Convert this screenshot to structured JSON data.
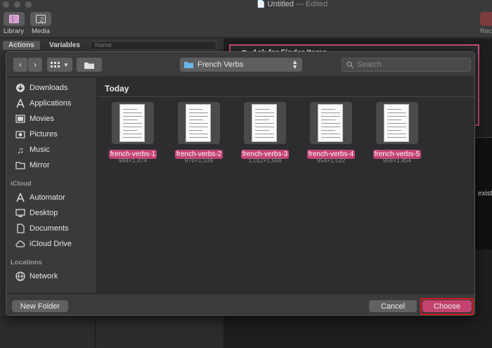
{
  "window": {
    "title": "Untitled",
    "status": " — Edited"
  },
  "toolbar": {
    "library_label": "Library",
    "media_label": "Media",
    "record_label": "Rec"
  },
  "library": {
    "tabs": [
      "Actions",
      "Variables"
    ],
    "search_placeholder": "Name"
  },
  "workflow": {
    "action_title": "Ask for Finder Items",
    "truncated_text": "existin"
  },
  "panel": {
    "location": "French Verbs",
    "search_placeholder": "Search",
    "section_today": "Today",
    "sidebar": {
      "favorites": [
        {
          "label": "Downloads",
          "icon": "downloads-icon"
        },
        {
          "label": "Applications",
          "icon": "applications-icon"
        },
        {
          "label": "Movies",
          "icon": "movies-icon"
        },
        {
          "label": "Pictures",
          "icon": "pictures-icon"
        },
        {
          "label": "Music",
          "icon": "music-icon"
        },
        {
          "label": "Mirror",
          "icon": "folder-icon"
        }
      ],
      "icloud_header": "iCloud",
      "icloud": [
        {
          "label": "Automator",
          "icon": "automator-icon"
        },
        {
          "label": "Desktop",
          "icon": "desktop-icon"
        },
        {
          "label": "Documents",
          "icon": "documents-icon"
        },
        {
          "label": "iCloud Drive",
          "icon": "cloud-icon"
        }
      ],
      "locations_header": "Locations",
      "locations": [
        {
          "label": "Network",
          "icon": "network-icon"
        }
      ]
    },
    "files": [
      {
        "name": "french-verbs-1",
        "dims": "984×1,474"
      },
      {
        "name": "french-verbs-2",
        "dims": "976×1,538"
      },
      {
        "name": "french-verbs-3",
        "dims": "1,012×1,556"
      },
      {
        "name": "french-verbs-4",
        "dims": "954×1,522"
      },
      {
        "name": "french-verbs-5",
        "dims": "958×1,454"
      }
    ],
    "buttons": {
      "new_folder": "New Folder",
      "cancel": "Cancel",
      "choose": "Choose"
    }
  },
  "colors": {
    "accent": "#c2436f",
    "highlight_ring": "#d21a1a"
  }
}
